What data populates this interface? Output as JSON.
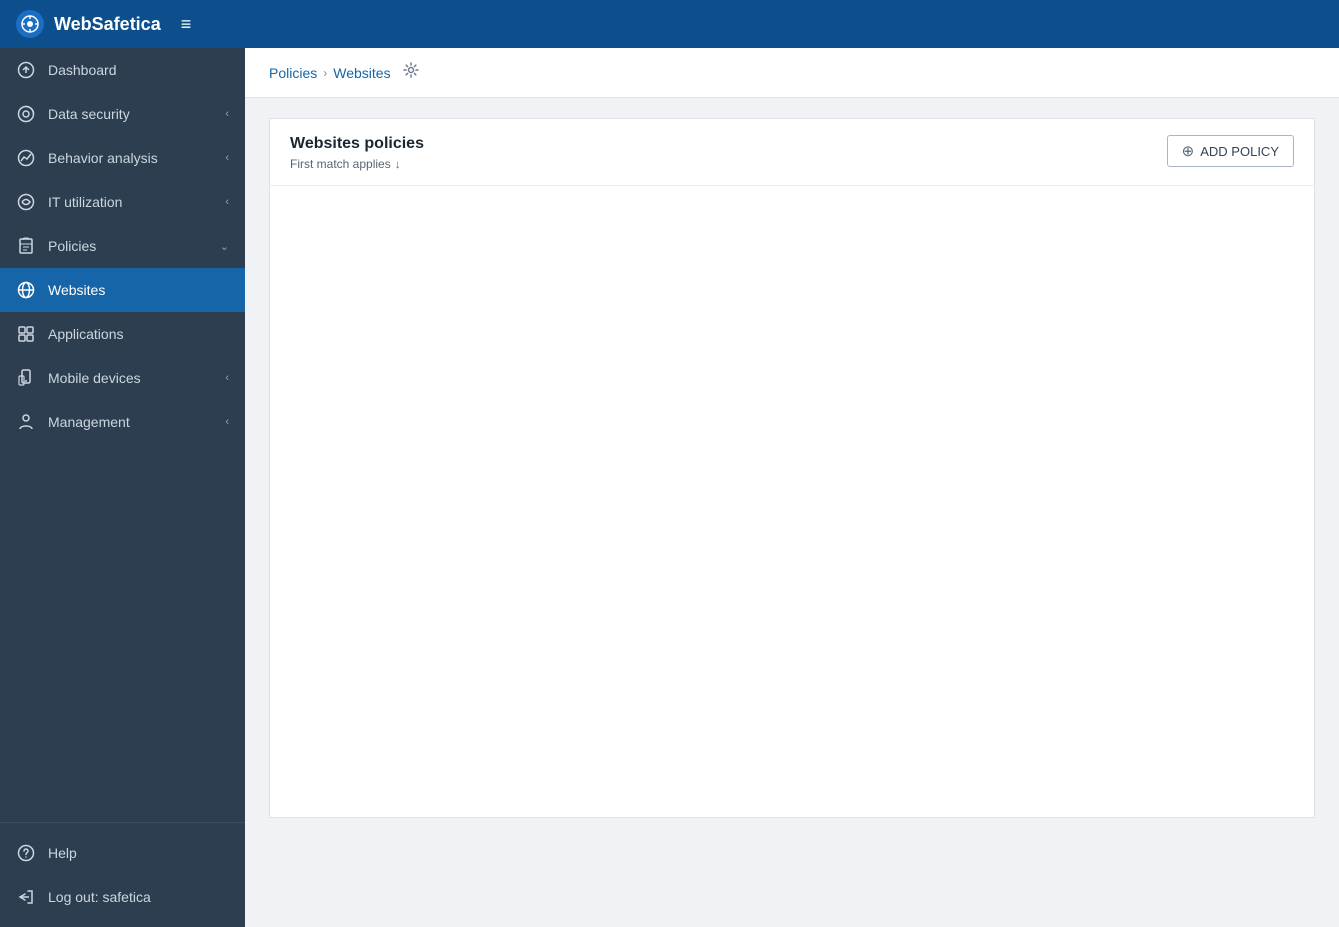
{
  "app": {
    "name": "WebSafetica",
    "menu_icon": "≡"
  },
  "topbar": {
    "logo_icon": "🛡"
  },
  "sidebar": {
    "items": [
      {
        "id": "dashboard",
        "label": "Dashboard",
        "icon": "dashboard",
        "chevron": false,
        "active": false
      },
      {
        "id": "data-security",
        "label": "Data security",
        "icon": "data-security",
        "chevron": true,
        "active": false
      },
      {
        "id": "behavior-analysis",
        "label": "Behavior analysis",
        "icon": "behavior-analysis",
        "chevron": true,
        "active": false
      },
      {
        "id": "it-utilization",
        "label": "IT utilization",
        "icon": "it-utilization",
        "chevron": true,
        "active": false
      },
      {
        "id": "policies",
        "label": "Policies",
        "icon": "policies",
        "chevron": "down",
        "active": false
      },
      {
        "id": "websites",
        "label": "Websites",
        "icon": "websites",
        "chevron": false,
        "active": true
      },
      {
        "id": "applications",
        "label": "Applications",
        "icon": "applications",
        "chevron": false,
        "active": false
      },
      {
        "id": "mobile-devices",
        "label": "Mobile devices",
        "icon": "mobile-devices",
        "chevron": true,
        "active": false
      },
      {
        "id": "management",
        "label": "Management",
        "icon": "management",
        "chevron": true,
        "active": false
      }
    ],
    "bottom_items": [
      {
        "id": "help",
        "label": "Help",
        "icon": "help"
      },
      {
        "id": "logout",
        "label": "Log out: safetica",
        "icon": "logout"
      }
    ]
  },
  "breadcrumb": {
    "parent": "Policies",
    "separator": "›",
    "current": "Websites",
    "gear_title": "Settings"
  },
  "policy_panel": {
    "title": "Websites policies",
    "subtitle": "First match applies",
    "add_button": "ADD POLICY"
  }
}
